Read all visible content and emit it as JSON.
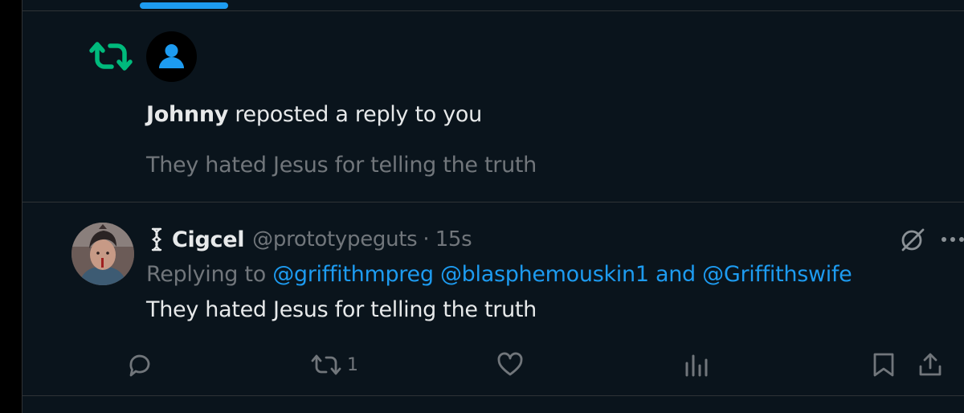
{
  "notification": {
    "actor": "Johnny",
    "action_text": " reposted a reply to you",
    "preview_text": "They hated Jesus for telling the truth"
  },
  "tweet": {
    "display_name": "Cigcel",
    "handle": "@prototypeguts",
    "separator": "·",
    "time": "15s",
    "replying_prefix": "Replying to ",
    "mentions": [
      "@griffithmpreg",
      "@blasphemouskin1"
    ],
    "mention_conjunction": " and ",
    "last_mention": "@Griffithswife",
    "text": "They hated Jesus for telling the truth"
  },
  "actions": {
    "repost_count": "1"
  },
  "icons": {
    "repost_notification": "repost-icon",
    "default_avatar": "default-avatar-icon",
    "badge": "badge-icon",
    "grok": "grok-icon",
    "more": "more-icon",
    "reply": "reply-icon",
    "repost": "repost-icon",
    "like": "heart-icon",
    "views": "views-icon",
    "bookmark": "bookmark-icon",
    "share": "share-icon"
  },
  "colors": {
    "background": "#0a141c",
    "accent": "#1d9bf0",
    "repost_green": "#00ba7c",
    "text_primary": "#e7e9ea",
    "text_secondary": "#71767b",
    "divider": "#2f3336"
  }
}
